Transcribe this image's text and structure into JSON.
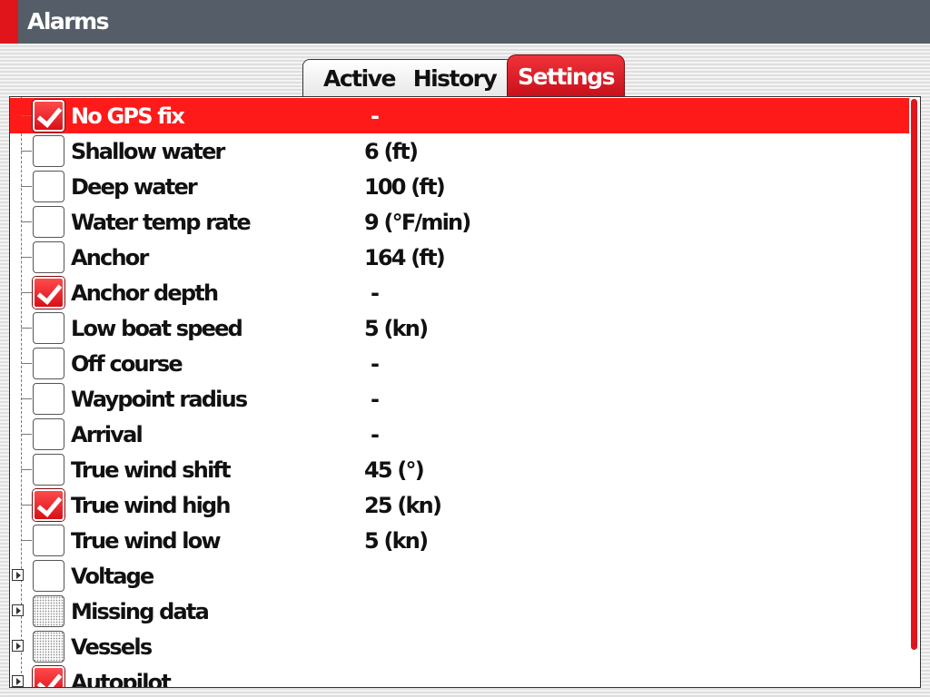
{
  "window": {
    "title": "Alarms"
  },
  "tabs": {
    "active": "Active",
    "history": "History",
    "settings": "Settings"
  },
  "alarms": [
    {
      "label": "No GPS fix",
      "value": "-",
      "checked": true,
      "selected": true
    },
    {
      "label": "Shallow water",
      "value": "6 (ft)",
      "checked": false
    },
    {
      "label": "Deep water",
      "value": "100 (ft)",
      "checked": false
    },
    {
      "label": "Water temp rate",
      "value": "9 (°F/min)",
      "checked": false
    },
    {
      "label": "Anchor",
      "value": "164 (ft)",
      "checked": false
    },
    {
      "label": "Anchor depth",
      "value": "-",
      "checked": true
    },
    {
      "label": "Low boat speed",
      "value": "5 (kn)",
      "checked": false
    },
    {
      "label": "Off course",
      "value": "-",
      "checked": false
    },
    {
      "label": "Waypoint radius",
      "value": "-",
      "checked": false
    },
    {
      "label": "Arrival",
      "value": "-",
      "checked": false
    },
    {
      "label": "True wind shift",
      "value": "45 (°)",
      "checked": false
    },
    {
      "label": "True wind high",
      "value": "25 (kn)",
      "checked": true
    },
    {
      "label": "True wind low",
      "value": "5 (kn)",
      "checked": false
    },
    {
      "label": "Voltage",
      "value": "",
      "checked": false,
      "expandable": true
    },
    {
      "label": "Missing data",
      "value": "",
      "state": "partial",
      "expandable": true
    },
    {
      "label": "Vessels",
      "value": "",
      "state": "partial",
      "expandable": true
    },
    {
      "label": "Autopilot",
      "value": "",
      "checked": true,
      "expandable": true
    }
  ],
  "colors": {
    "accent": "#e0141b",
    "titlebar": "#555e68",
    "selected_row": "#ff1a1a"
  }
}
